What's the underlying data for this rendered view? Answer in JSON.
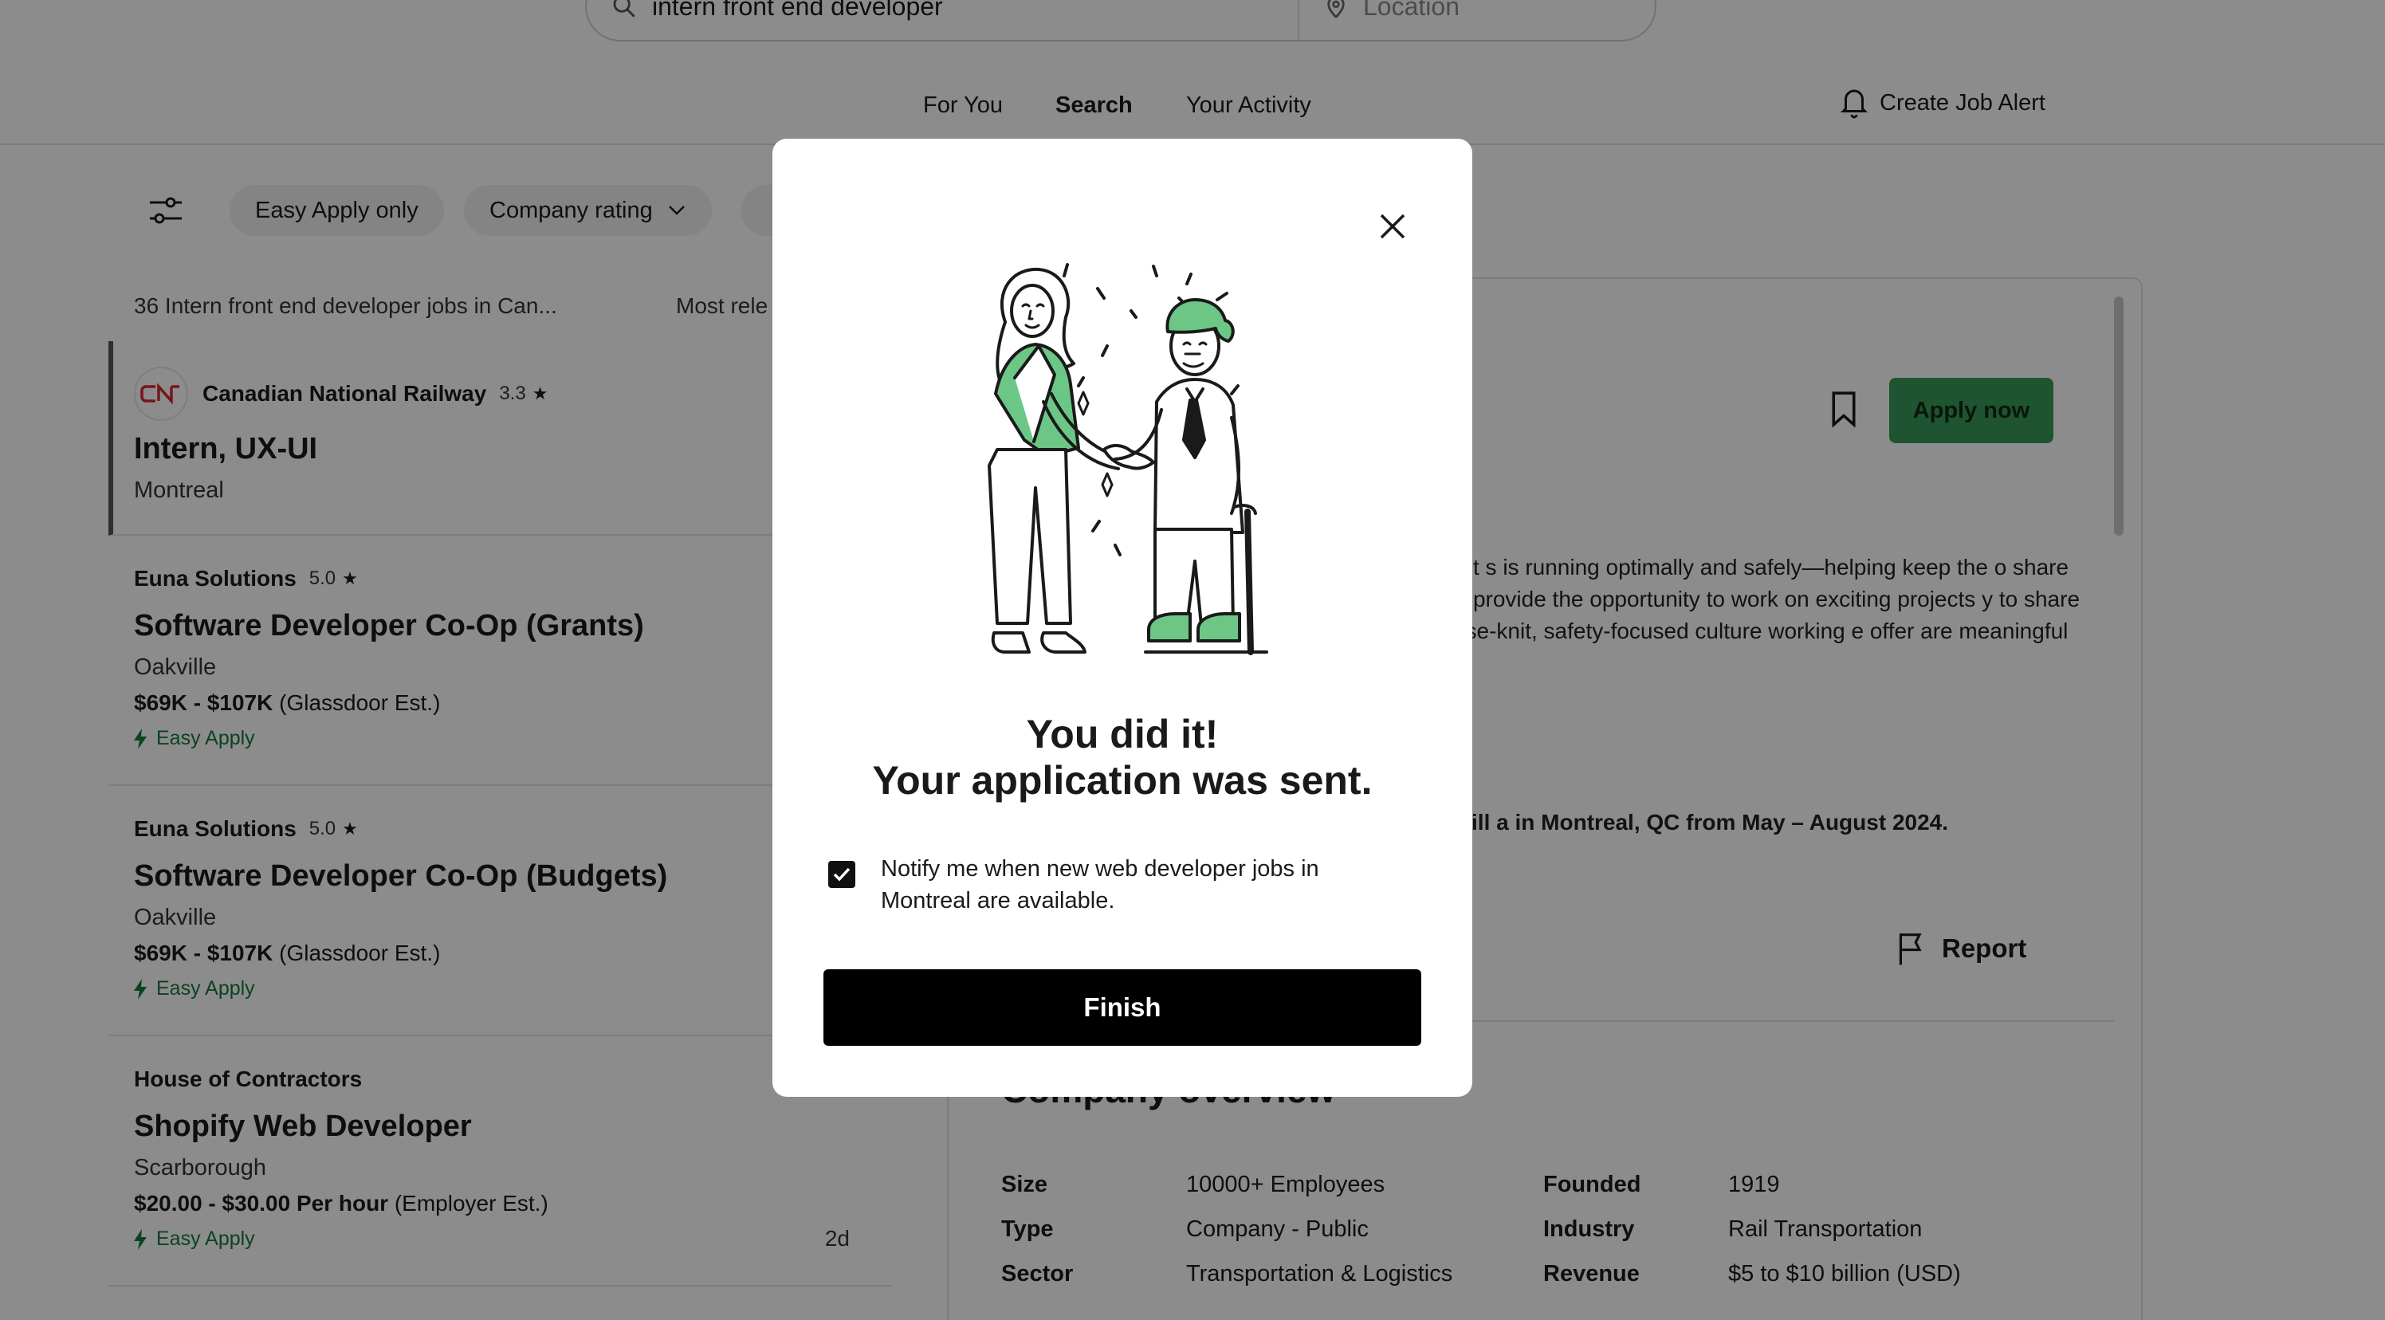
{
  "search": {
    "query": "intern front end developer",
    "location_placeholder": "Location"
  },
  "nav": {
    "for_you": "For You",
    "search": "Search",
    "your_activity": "Your Activity",
    "create_job_alert": "Create Job Alert"
  },
  "filters": {
    "easy_apply": "Easy Apply only",
    "company_rating": "Company rating"
  },
  "results": {
    "count_text": "36 Intern front end developer jobs in Can...",
    "sort_label": "Most rele"
  },
  "jobs": [
    {
      "company": "Canadian National Railway",
      "rating": "3.3",
      "title": "Intern, UX-UI",
      "location": "Montreal"
    },
    {
      "company": "Euna Solutions",
      "rating": "5.0",
      "title": "Software Developer Co-Op (Grants)",
      "location": "Oakville",
      "salary": "$69K - $107K",
      "salary_note": "(Glassdoor Est.)",
      "easy_apply": "Easy Apply"
    },
    {
      "company": "Euna Solutions",
      "rating": "5.0",
      "title": "Software Developer Co-Op (Budgets)",
      "location": "Oakville",
      "salary": "$69K - $107K",
      "salary_note": "(Glassdoor Est.)",
      "easy_apply": "Easy Apply"
    },
    {
      "company": "House of Contractors",
      "title": "Shopify Web Developer",
      "location": "Scarborough",
      "salary": "$20.00 - $30.00 Per hour",
      "salary_note": "(Employer Est.)",
      "easy_apply": "Easy Apply",
      "posted": "2d"
    }
  ],
  "detail": {
    "apply_label": "Apply now",
    "description": "lenges. You can expect an interesting environment s is running optimally and safely—helping keep the o share their ideas, perspectives and understanding of ve provide the opportunity to work on exciting projects y to share their knowledge, all within a mutually- e in our close-knit, safety-focused culture working e offer are meaningful because the work we do",
    "description_bold": "is looking for a highly motivated person to fulfill a in Montreal, QC from May – August 2024.",
    "report_label": "Report",
    "overview_title": "Company overview",
    "overview": {
      "size_label": "Size",
      "size": "10000+ Employees",
      "founded_label": "Founded",
      "founded": "1919",
      "type_label": "Type",
      "type": "Company - Public",
      "industry_label": "Industry",
      "industry": "Rail Transportation",
      "sector_label": "Sector",
      "sector": "Transportation & Logistics",
      "revenue_label": "Revenue",
      "revenue": "$5 to $10 billion (USD)"
    }
  },
  "modal": {
    "headline_line1": "You did it!",
    "headline_line2": "Your application was sent.",
    "notify_text": "Notify me when new web developer jobs in Montreal are available.",
    "notify_checked": true,
    "finish_label": "Finish"
  },
  "colors": {
    "accent_green": "#3a9a59",
    "easy_apply_green": "#137a3c",
    "illustration_green": "#6cc787"
  }
}
